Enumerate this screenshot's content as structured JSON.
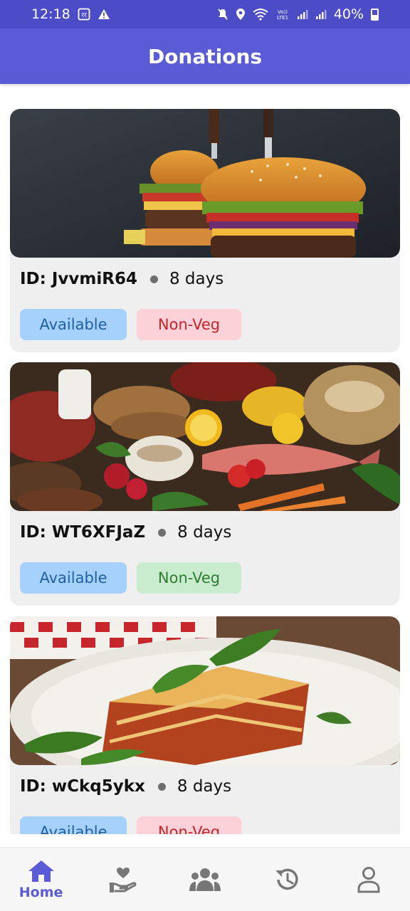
{
  "status_bar": {
    "time": "12:18",
    "battery": "40%",
    "icons": [
      "sim-icon",
      "warning-icon",
      "mute-icon",
      "location-icon",
      "wifi-icon",
      "volte-icon",
      "signal-icon",
      "signal-icon",
      "battery-icon"
    ]
  },
  "app_bar": {
    "title": "Donations"
  },
  "donations": [
    {
      "id": "ID: JvvmiR64",
      "age": "8 days",
      "status": "Available",
      "type": "Non-Veg",
      "type_color": "red",
      "image": "burgers"
    },
    {
      "id": "ID: WT6XFJaZ",
      "age": "8 days",
      "status": "Available",
      "type": "Non-Veg",
      "type_color": "green",
      "image": "groceries"
    },
    {
      "id": "ID: wCkq5ykx",
      "age": "8 days",
      "status": "Available",
      "type": "Non-Veg",
      "type_color": "red",
      "image": "lasagna"
    }
  ],
  "bottom_nav": {
    "items": [
      {
        "label": "Home",
        "icon": "home-icon",
        "active": true
      },
      {
        "label": "",
        "icon": "donate-hand-icon",
        "active": false
      },
      {
        "label": "",
        "icon": "group-icon",
        "active": false
      },
      {
        "label": "",
        "icon": "history-icon",
        "active": false
      },
      {
        "label": "",
        "icon": "profile-icon",
        "active": false
      }
    ]
  },
  "colors": {
    "primary": "#5b5bd6",
    "status_bar": "#4b4cc6",
    "available_bg": "#a6d1fb",
    "nonveg_red_bg": "#fdd1d8",
    "nonveg_green_bg": "#c9ebce"
  }
}
